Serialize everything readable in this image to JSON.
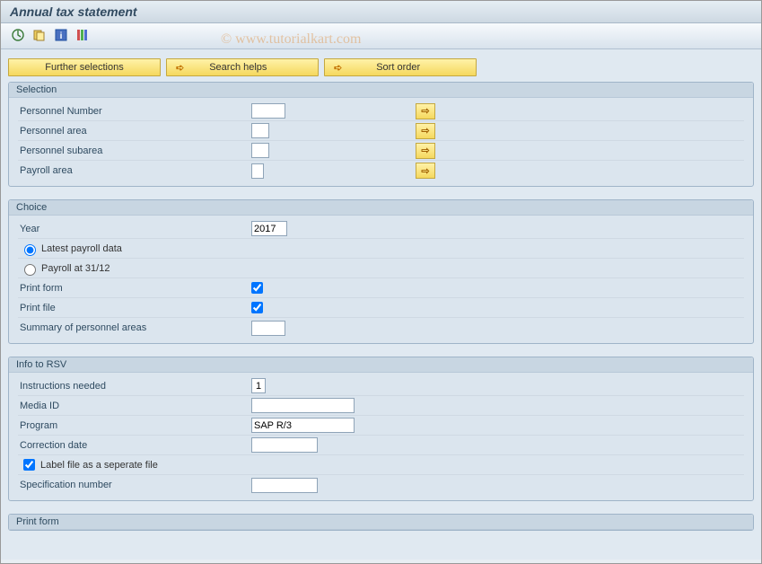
{
  "title": "Annual tax statement",
  "watermark": "© www.tutorialkart.com",
  "toolbar_icons": {
    "execute": "execute-icon",
    "variants": "variants-icon",
    "info": "info-icon",
    "more": "more-icon"
  },
  "buttons": {
    "further_selections": "Further selections",
    "search_helps": "Search helps",
    "sort_order": "Sort order"
  },
  "groups": {
    "selection": {
      "title": "Selection",
      "rows": {
        "personnel_number": {
          "label": "Personnel Number",
          "value": ""
        },
        "personnel_area": {
          "label": "Personnel area",
          "value": ""
        },
        "personnel_subarea": {
          "label": "Personnel subarea",
          "value": ""
        },
        "payroll_area": {
          "label": "Payroll area",
          "value": ""
        }
      }
    },
    "choice": {
      "title": "Choice",
      "year": {
        "label": "Year",
        "value": "2017"
      },
      "radios": {
        "latest": "Latest payroll data",
        "at3112": "Payroll at 31/12"
      },
      "print_form": {
        "label": "Print form",
        "checked": true
      },
      "print_file": {
        "label": "Print file",
        "checked": true
      },
      "summary": {
        "label": "Summary of personnel areas",
        "value": ""
      }
    },
    "info_rsv": {
      "title": "Info to RSV",
      "instructions": {
        "label": "Instructions needed",
        "value": "1"
      },
      "media_id": {
        "label": "Media ID",
        "value": ""
      },
      "program": {
        "label": "Program",
        "value": "SAP R/3"
      },
      "correction_date": {
        "label": "Correction date",
        "value": ""
      },
      "label_file": {
        "label": "Label file as a seperate file",
        "checked": true
      },
      "spec_number": {
        "label": "Specification number",
        "value": ""
      }
    },
    "print_form_group": {
      "title": "Print form"
    }
  }
}
